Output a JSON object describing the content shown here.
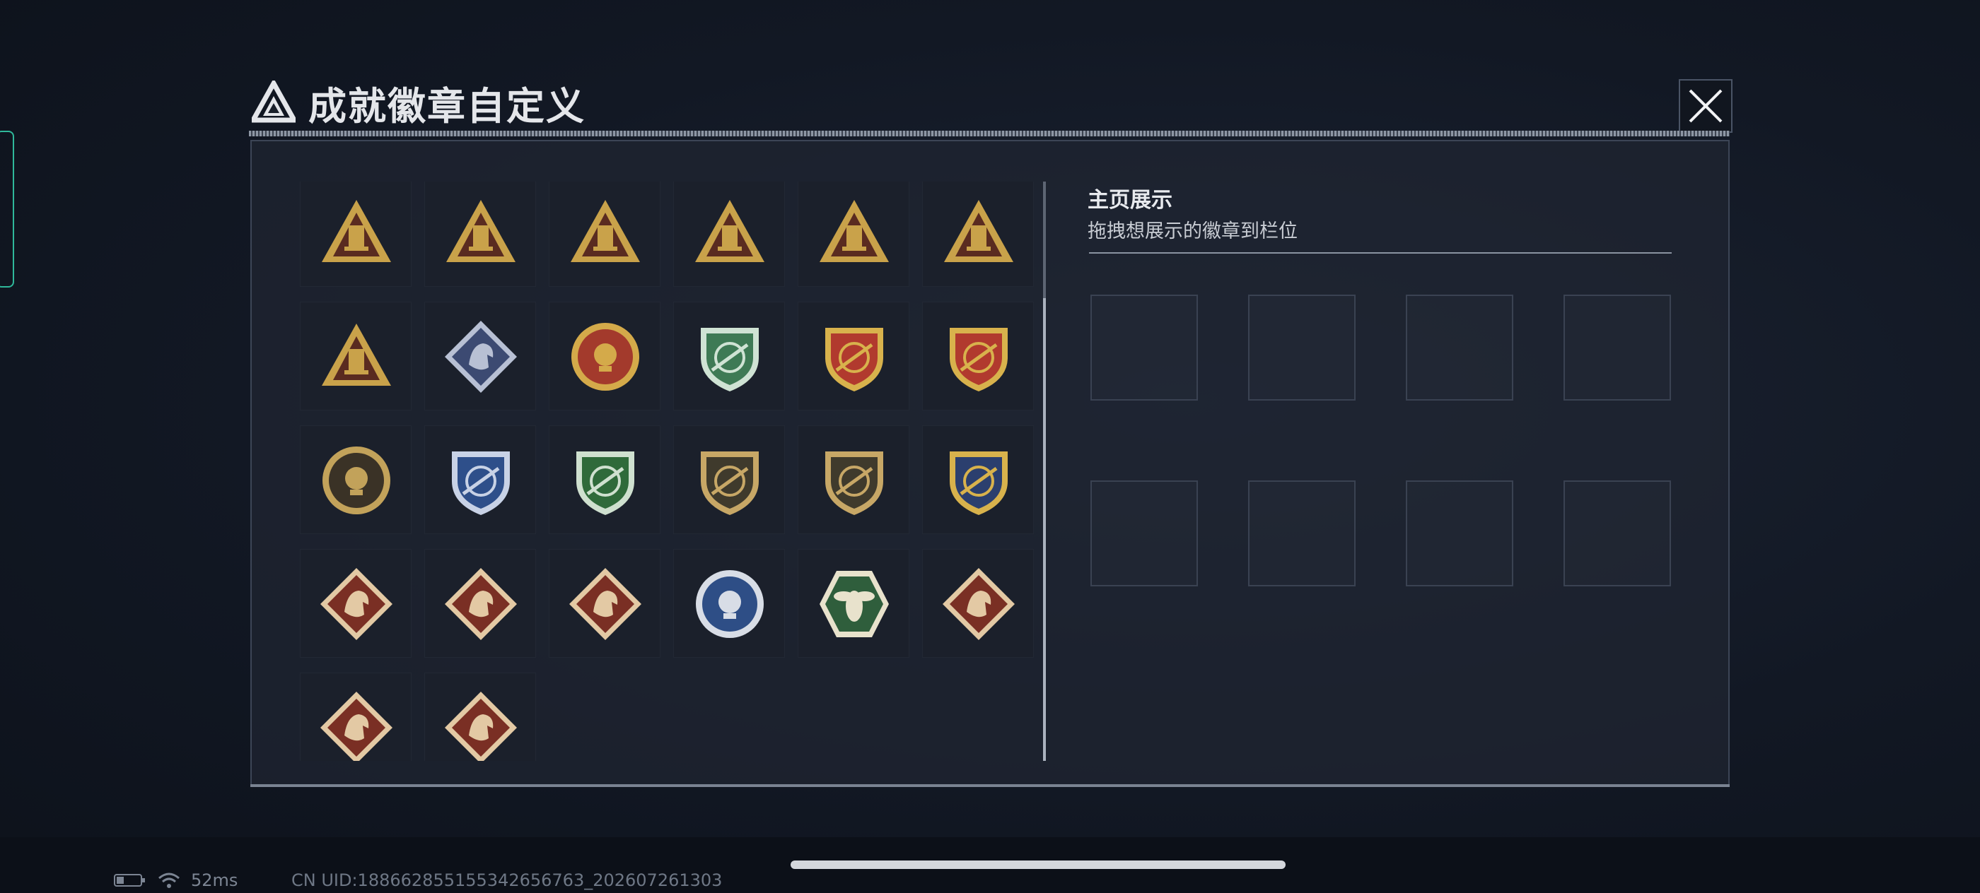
{
  "modal": {
    "title": "成就徽章自定义",
    "close_icon": "close-icon"
  },
  "badges": [
    {
      "name": "gold-triangle-cannon",
      "shape": "triangle",
      "color": "#c9a24a",
      "bg": "#5a2b20"
    },
    {
      "name": "gold-triangle-beta",
      "shape": "triangle",
      "color": "#c9a24a",
      "bg": "#5a2b20"
    },
    {
      "name": "gold-triangle-sunrise",
      "shape": "triangle",
      "color": "#c9a24a",
      "bg": "#5a2b20"
    },
    {
      "name": "gold-triangle-number-one",
      "shape": "triangle",
      "color": "#c9a24a",
      "bg": "#5a2b20"
    },
    {
      "name": "gold-triangle-capsule",
      "shape": "triangle",
      "color": "#c9a24a",
      "bg": "#5a2b20"
    },
    {
      "name": "gold-triangle-soldiers",
      "shape": "triangle",
      "color": "#c9a24a",
      "bg": "#5a2b20"
    },
    {
      "name": "gold-triangle-tower",
      "shape": "triangle",
      "color": "#c9a24a",
      "bg": "#5a2b20"
    },
    {
      "name": "silver-diamond-rose",
      "shape": "diamond",
      "color": "#b8c0d4",
      "bg": "#3c4a72"
    },
    {
      "name": "red-gold-star-medal",
      "shape": "circle",
      "color": "#d4aa4a",
      "bg": "#a33a2c"
    },
    {
      "name": "green-shield-emblem",
      "shape": "shield",
      "color": "#cfe3d4",
      "bg": "#3e7a55"
    },
    {
      "name": "red-shield-winged-medal",
      "shape": "shield",
      "color": "#d8b24c",
      "bg": "#b13a2e"
    },
    {
      "name": "red-shield-star-medal",
      "shape": "shield",
      "color": "#d8b24c",
      "bg": "#b13a2e"
    },
    {
      "name": "gold-circle-skull",
      "shape": "circle",
      "color": "#c2a25a",
      "bg": "#3a3226"
    },
    {
      "name": "blue-shield-rifle",
      "shape": "shield",
      "color": "#c8d2e6",
      "bg": "#2e4f8a"
    },
    {
      "name": "green-shield-rifle",
      "shape": "shield",
      "color": "#cfe0cf",
      "bg": "#2f6a3a"
    },
    {
      "name": "bronze-shield-rifle",
      "shape": "shield",
      "color": "#c7a766",
      "bg": "#3f3a2c"
    },
    {
      "name": "bronze-shield-sniper",
      "shape": "shield",
      "color": "#c7a766",
      "bg": "#3f3a2c"
    },
    {
      "name": "navy-gold-shield-crosshair",
      "shape": "shield",
      "color": "#d8b24c",
      "bg": "#2b3f6e"
    },
    {
      "name": "red-diamond-wolf",
      "shape": "diamond",
      "color": "#e3c9a4",
      "bg": "#7a2f24"
    },
    {
      "name": "red-diamond-wolf-roar",
      "shape": "diamond",
      "color": "#e3c9a4",
      "bg": "#7a2f24"
    },
    {
      "name": "red-diamond-grip",
      "shape": "diamond",
      "color": "#e3c9a4",
      "bg": "#7a2f24"
    },
    {
      "name": "blue-circle-eagle",
      "shape": "circle",
      "color": "#d8dde6",
      "bg": "#2e4e86"
    },
    {
      "name": "green-hexagon-hornet",
      "shape": "hexagon",
      "color": "#e8e2cc",
      "bg": "#2f5e3c"
    },
    {
      "name": "red-diamond-dragon",
      "shape": "diamond",
      "color": "#e3c9a4",
      "bg": "#7a2f24"
    },
    {
      "name": "red-diamond-dragon-head",
      "shape": "diamond",
      "color": "#e3c9a4",
      "bg": "#7a2f24"
    },
    {
      "name": "red-diamond-runner",
      "shape": "diamond",
      "color": "#e3c9a4",
      "bg": "#7a2f24"
    }
  ],
  "showcase": {
    "title": "主页展示",
    "hint": "拖拽想展示的徽章到栏位"
  },
  "status": {
    "ping": "52ms",
    "uid": "CN UID:18866285515534265676​3_202607261303"
  }
}
